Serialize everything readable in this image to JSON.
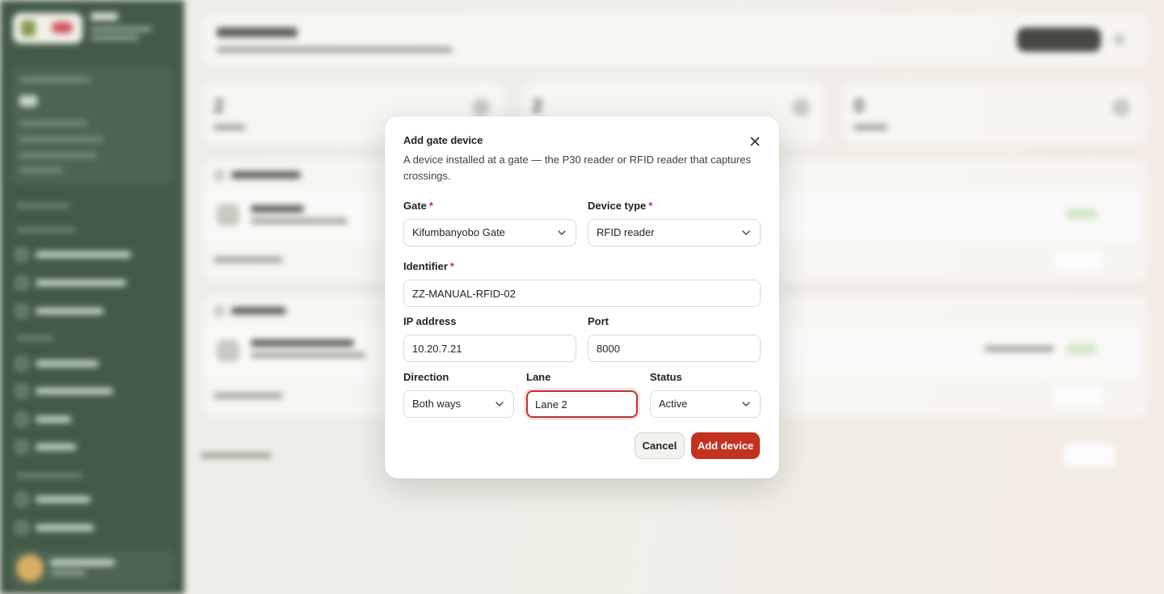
{
  "modal": {
    "title": "Add gate device",
    "description": "A device installed at a gate — the P30 reader or RFID reader that captures crossings.",
    "close_icon": "close-icon",
    "fields": {
      "gate": {
        "label": "Gate",
        "required_mark": "*",
        "value": "Kifumbanyobo Gate"
      },
      "device_type": {
        "label": "Device type",
        "required_mark": "*",
        "value": "RFID reader"
      },
      "identifier": {
        "label": "Identifier",
        "required_mark": "*",
        "value": "ZZ-MANUAL-RFID-02"
      },
      "ip_address": {
        "label": "IP address",
        "value": "10.20.7.21"
      },
      "port": {
        "label": "Port",
        "value": "8000"
      },
      "direction": {
        "label": "Direction",
        "value": "Both ways"
      },
      "lane": {
        "label": "Lane",
        "value": "Lane 2"
      },
      "status": {
        "label": "Status",
        "value": "Active"
      }
    },
    "buttons": {
      "cancel": "Cancel",
      "add": "Add device"
    }
  },
  "background": {
    "stats": [
      "2",
      "2",
      "0"
    ]
  },
  "colors": {
    "sidebar": "#1f3a25",
    "accent": "#c2331f",
    "focus_ring": "#c6322b"
  }
}
